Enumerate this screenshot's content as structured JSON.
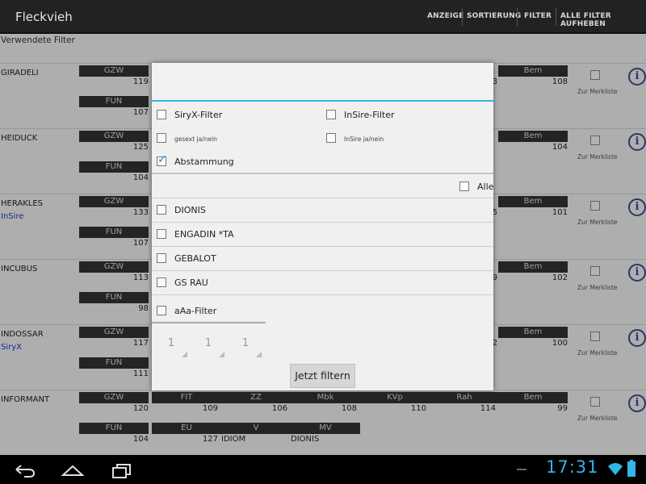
{
  "app": {
    "title": "Fleckvieh"
  },
  "menu": [
    "ANZEIGE",
    "SORTIERUNG",
    "FILTER",
    "ALLE FILTER AUFHEBEN"
  ],
  "used_filters_label": "Verwendete Filter",
  "labels": {
    "gzw": "GZW",
    "fit": "FIT",
    "zz": "ZZ",
    "mbk": "Mbk",
    "kvp": "KVp",
    "rah": "Rah",
    "bem": "Bem",
    "fun": "FUN",
    "eu": "EU",
    "v": "V",
    "mv": "MV",
    "merkliste": "Zur Merkliste",
    "info": "i"
  },
  "animals": [
    {
      "name": "GIRADELI",
      "tag": "",
      "gzw": "119",
      "fun": "107",
      "bem": "108",
      "partial": "3"
    },
    {
      "name": "HEIDUCK",
      "tag": "",
      "gzw": "125",
      "fun": "104",
      "bem": "104",
      "partial": ""
    },
    {
      "name": "HERAKLES",
      "tag": "InSire",
      "gzw": "133",
      "fun": "107",
      "bem": "101",
      "partial": "5"
    },
    {
      "name": "INCUBUS",
      "tag": "",
      "gzw": "113",
      "fun": "98",
      "bem": "102",
      "partial": "9"
    },
    {
      "name": "INDOSSAR",
      "tag": "SiryX",
      "gzw": "117",
      "fun": "111",
      "bem": "100",
      "partial": "2"
    },
    {
      "name": "INFORMANT",
      "tag": "",
      "gzw": "120",
      "fit": "109",
      "zz": "106",
      "mbk": "108",
      "kvp": "110",
      "rah": "114",
      "bem": "99",
      "fun": "104",
      "eu": "127",
      "v": "IDIOM",
      "mv": "DIONIS"
    }
  ],
  "dialog": {
    "siryx_filter": "SiryX-Filter",
    "insire_filter": "InSire-Filter",
    "gesext": "gesext ja/nein",
    "insire_yn": "InSire ja/nein",
    "abstammung": "Abstammung",
    "alle": "Alle",
    "sires": [
      "DIONIS",
      "ENGADIN *TA",
      "GEBALOT",
      "GS RAU"
    ],
    "aaa_filter": "aAa-Filter",
    "spinners": [
      "1",
      "1",
      "1"
    ],
    "submit": "Jetzt filtern"
  },
  "status": {
    "time": "17:31"
  },
  "colors": {
    "accent": "#33b5e5",
    "label_bg": "#333333",
    "tag": "#1e3ec8"
  }
}
